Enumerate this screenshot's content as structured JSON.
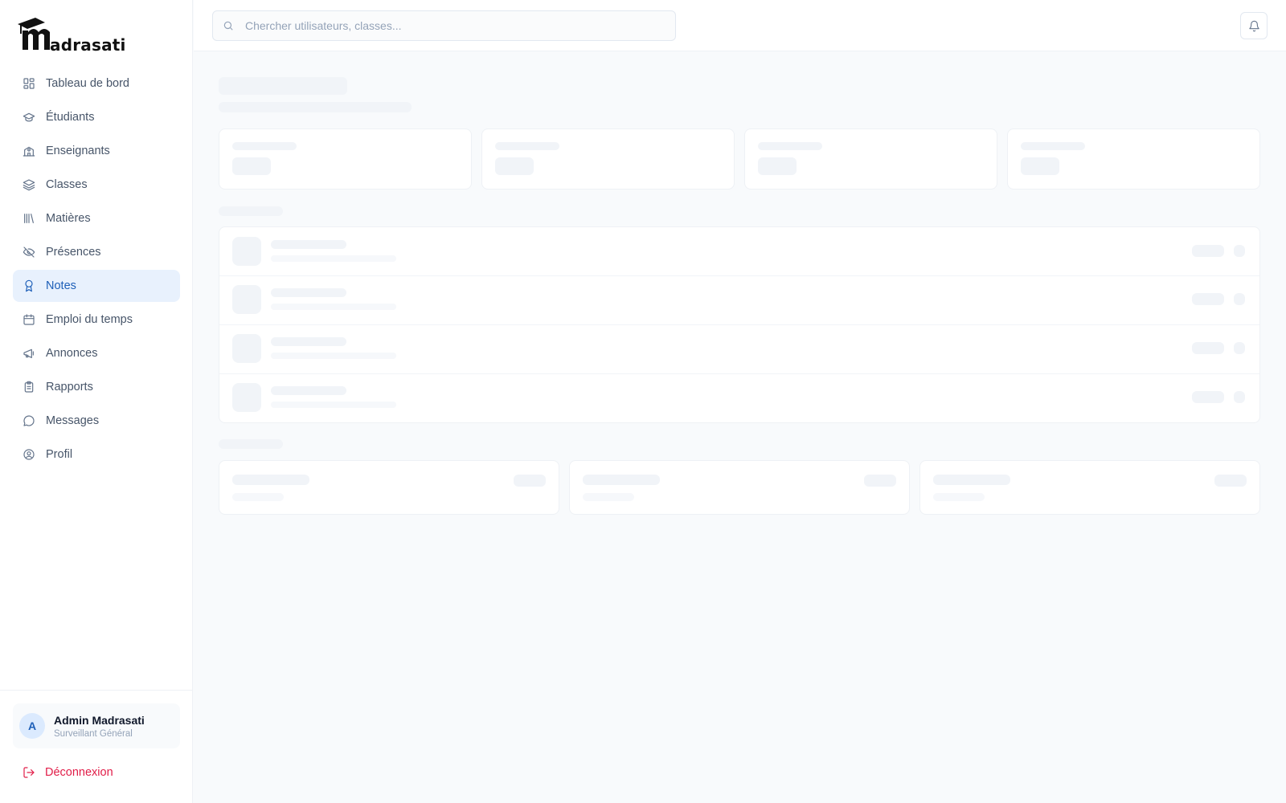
{
  "brand": {
    "logo_text": "adrasati"
  },
  "sidebar": {
    "items": [
      {
        "label": "Tableau de bord",
        "icon": "dashboard-icon"
      },
      {
        "label": "Étudiants",
        "icon": "graduation-cap-icon"
      },
      {
        "label": "Enseignants",
        "icon": "school-icon"
      },
      {
        "label": "Classes",
        "icon": "layers-icon"
      },
      {
        "label": "Matières",
        "icon": "library-icon"
      },
      {
        "label": "Présences",
        "icon": "eye-off-icon"
      },
      {
        "label": "Notes",
        "icon": "award-icon",
        "active": true
      },
      {
        "label": "Emploi du temps",
        "icon": "calendar-icon"
      },
      {
        "label": "Annonces",
        "icon": "megaphone-icon"
      },
      {
        "label": "Rapports",
        "icon": "clipboard-icon"
      },
      {
        "label": "Messages",
        "icon": "message-icon"
      },
      {
        "label": "Profil",
        "icon": "user-circle-icon"
      }
    ],
    "user": {
      "initial": "A",
      "name": "Admin Madrasati",
      "role": "Surveillant Général"
    },
    "logout_label": "Déconnexion"
  },
  "header": {
    "search_placeholder": "Chercher utilisateurs, classes..."
  },
  "colors": {
    "accent": "#1d5fb8",
    "active_bg": "#e8f1fd",
    "danger": "#e11d48"
  }
}
